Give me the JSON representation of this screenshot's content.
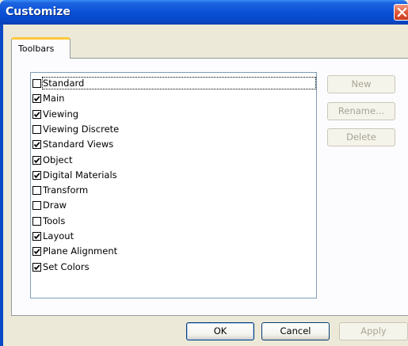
{
  "window": {
    "title": "Customize"
  },
  "tabs": [
    {
      "label": "Toolbars"
    }
  ],
  "toolbars": [
    {
      "label": "Standard",
      "checked": false,
      "focused": true
    },
    {
      "label": "Main",
      "checked": true
    },
    {
      "label": "Viewing",
      "checked": true
    },
    {
      "label": "Viewing Discrete",
      "checked": false
    },
    {
      "label": "Standard Views",
      "checked": true
    },
    {
      "label": "Object",
      "checked": true
    },
    {
      "label": "Digital Materials",
      "checked": true
    },
    {
      "label": "Transform",
      "checked": false
    },
    {
      "label": "Draw",
      "checked": false
    },
    {
      "label": "Tools",
      "checked": false
    },
    {
      "label": "Layout",
      "checked": true
    },
    {
      "label": "Plane Alignment",
      "checked": true
    },
    {
      "label": "Set Colors",
      "checked": true
    }
  ],
  "side_buttons": {
    "new": {
      "label": "New",
      "enabled": false
    },
    "rename": {
      "label": "Rename...",
      "enabled": false
    },
    "delete": {
      "label": "Delete",
      "enabled": false
    }
  },
  "footer": {
    "ok": {
      "label": "OK",
      "enabled": true
    },
    "cancel": {
      "label": "Cancel",
      "enabled": true
    },
    "apply": {
      "label": "Apply",
      "enabled": false
    }
  },
  "icons": {
    "close": "close-icon",
    "check": "checkmark-icon"
  },
  "colors": {
    "titlebar": "#0a51d8",
    "tab_accent": "#ffc83c",
    "dialog_bg": "#ece9d8"
  }
}
